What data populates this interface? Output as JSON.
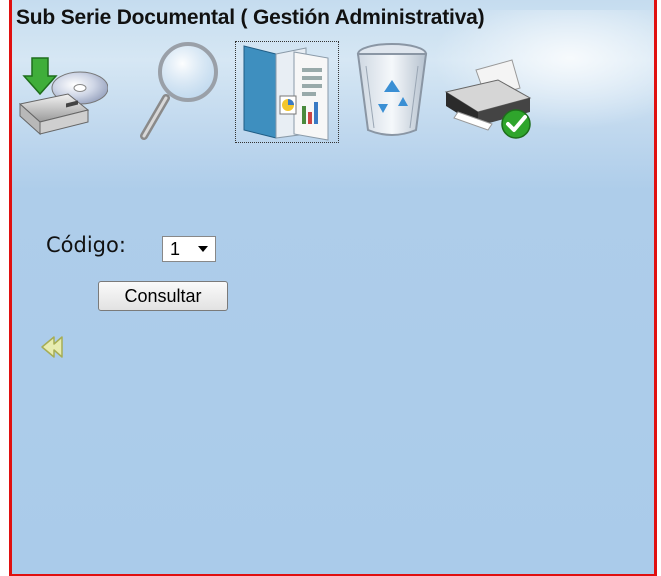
{
  "window": {
    "title": "Sub Serie Documental ( Gestión Administrativa)"
  },
  "toolbar": {
    "icons": [
      {
        "name": "export-disk-icon"
      },
      {
        "name": "search-icon"
      },
      {
        "name": "report-icon",
        "selected": true
      },
      {
        "name": "recycle-bin-icon"
      },
      {
        "name": "printer-icon"
      }
    ]
  },
  "form": {
    "codigo_label": "Código:",
    "codigo_value": "1",
    "consultar_label": "Consultar"
  },
  "nav": {
    "back_icon": "double-arrow-left-icon"
  },
  "colors": {
    "frame_border": "#e01010",
    "panel_background": "#aacbea"
  }
}
